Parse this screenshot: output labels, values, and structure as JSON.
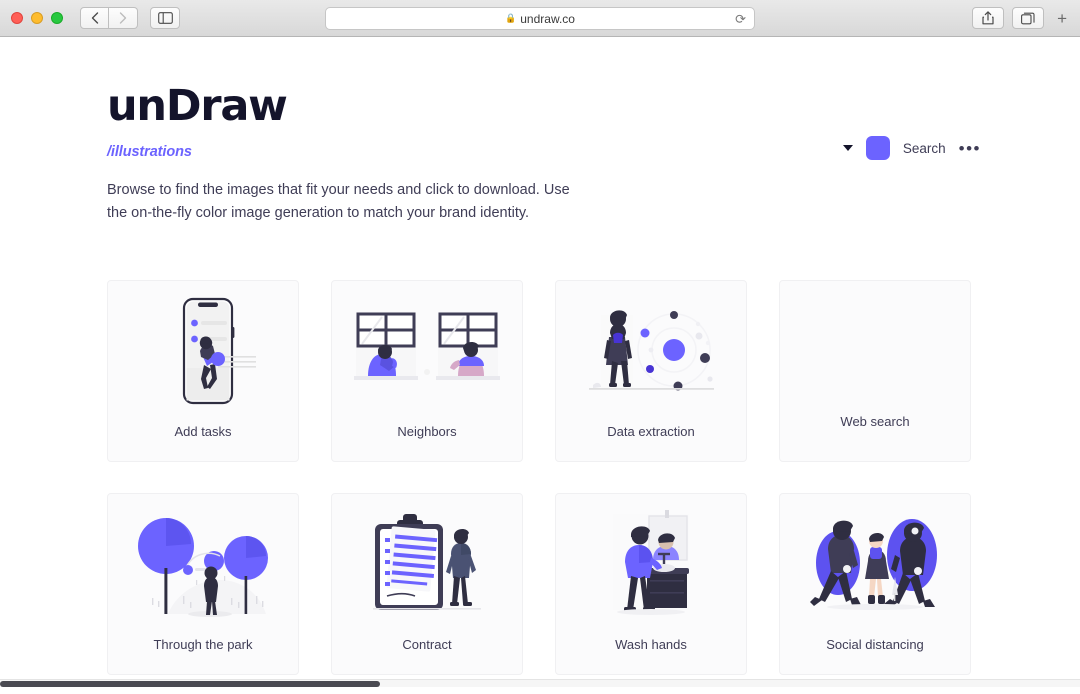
{
  "browser": {
    "back_icon": "chevron-left-icon",
    "forward_icon": "chevron-right-icon",
    "sidebar_icon": "sidebar-toggle-icon",
    "lock_glyph": "🔒",
    "url": "undraw.co",
    "reload_glyph": "⟳",
    "share_icon": "share-icon",
    "tabs_icon": "tab-overview-icon",
    "new_tab_label": "+"
  },
  "header": {
    "brand": "unDraw",
    "breadcrumb": "/illustrations",
    "intro": "Browse to find the images that fit your needs and click to download. Use the on-the-fly color image generation to match your brand identity.",
    "search_label": "Search",
    "more_label": "•••",
    "accent_color": "#6c63ff",
    "swatch_color": "#6c63ff",
    "caret_icon": "chevron-down-icon",
    "swatch_name": "color-swatch"
  },
  "gallery": {
    "cards": [
      {
        "label": "Add tasks",
        "art": "phone"
      },
      {
        "label": "Neighbors",
        "art": "windows"
      },
      {
        "label": "Data extraction",
        "art": "nodes"
      },
      {
        "label": "Web search",
        "art": "none"
      },
      {
        "label": "Through the park",
        "art": "park"
      },
      {
        "label": "Contract",
        "art": "clipboard"
      },
      {
        "label": "Wash hands",
        "art": "sink"
      },
      {
        "label": "Social distancing",
        "art": "distancing"
      }
    ]
  },
  "scrollbar": {
    "name": "horizontal-scrollbar"
  }
}
